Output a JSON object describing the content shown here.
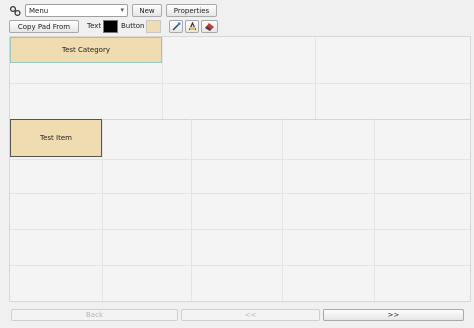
{
  "toolbar": {
    "menu_value": "Menu",
    "new_label": "New",
    "properties_label": "Properties",
    "copy_pad_label": "Copy Pad From",
    "text_label": "Text",
    "button_label": "Button",
    "colors": {
      "text_swatch": "#000000",
      "button_swatch": "#efdcb0"
    },
    "tools": [
      "paint-brush-icon",
      "text-style-icon",
      "eraser-icon"
    ]
  },
  "canvas": {
    "category": "Test Category",
    "item": "Test Item"
  },
  "nav": {
    "back_label": "Back",
    "prev_label": "<<",
    "next_label": ">>"
  }
}
